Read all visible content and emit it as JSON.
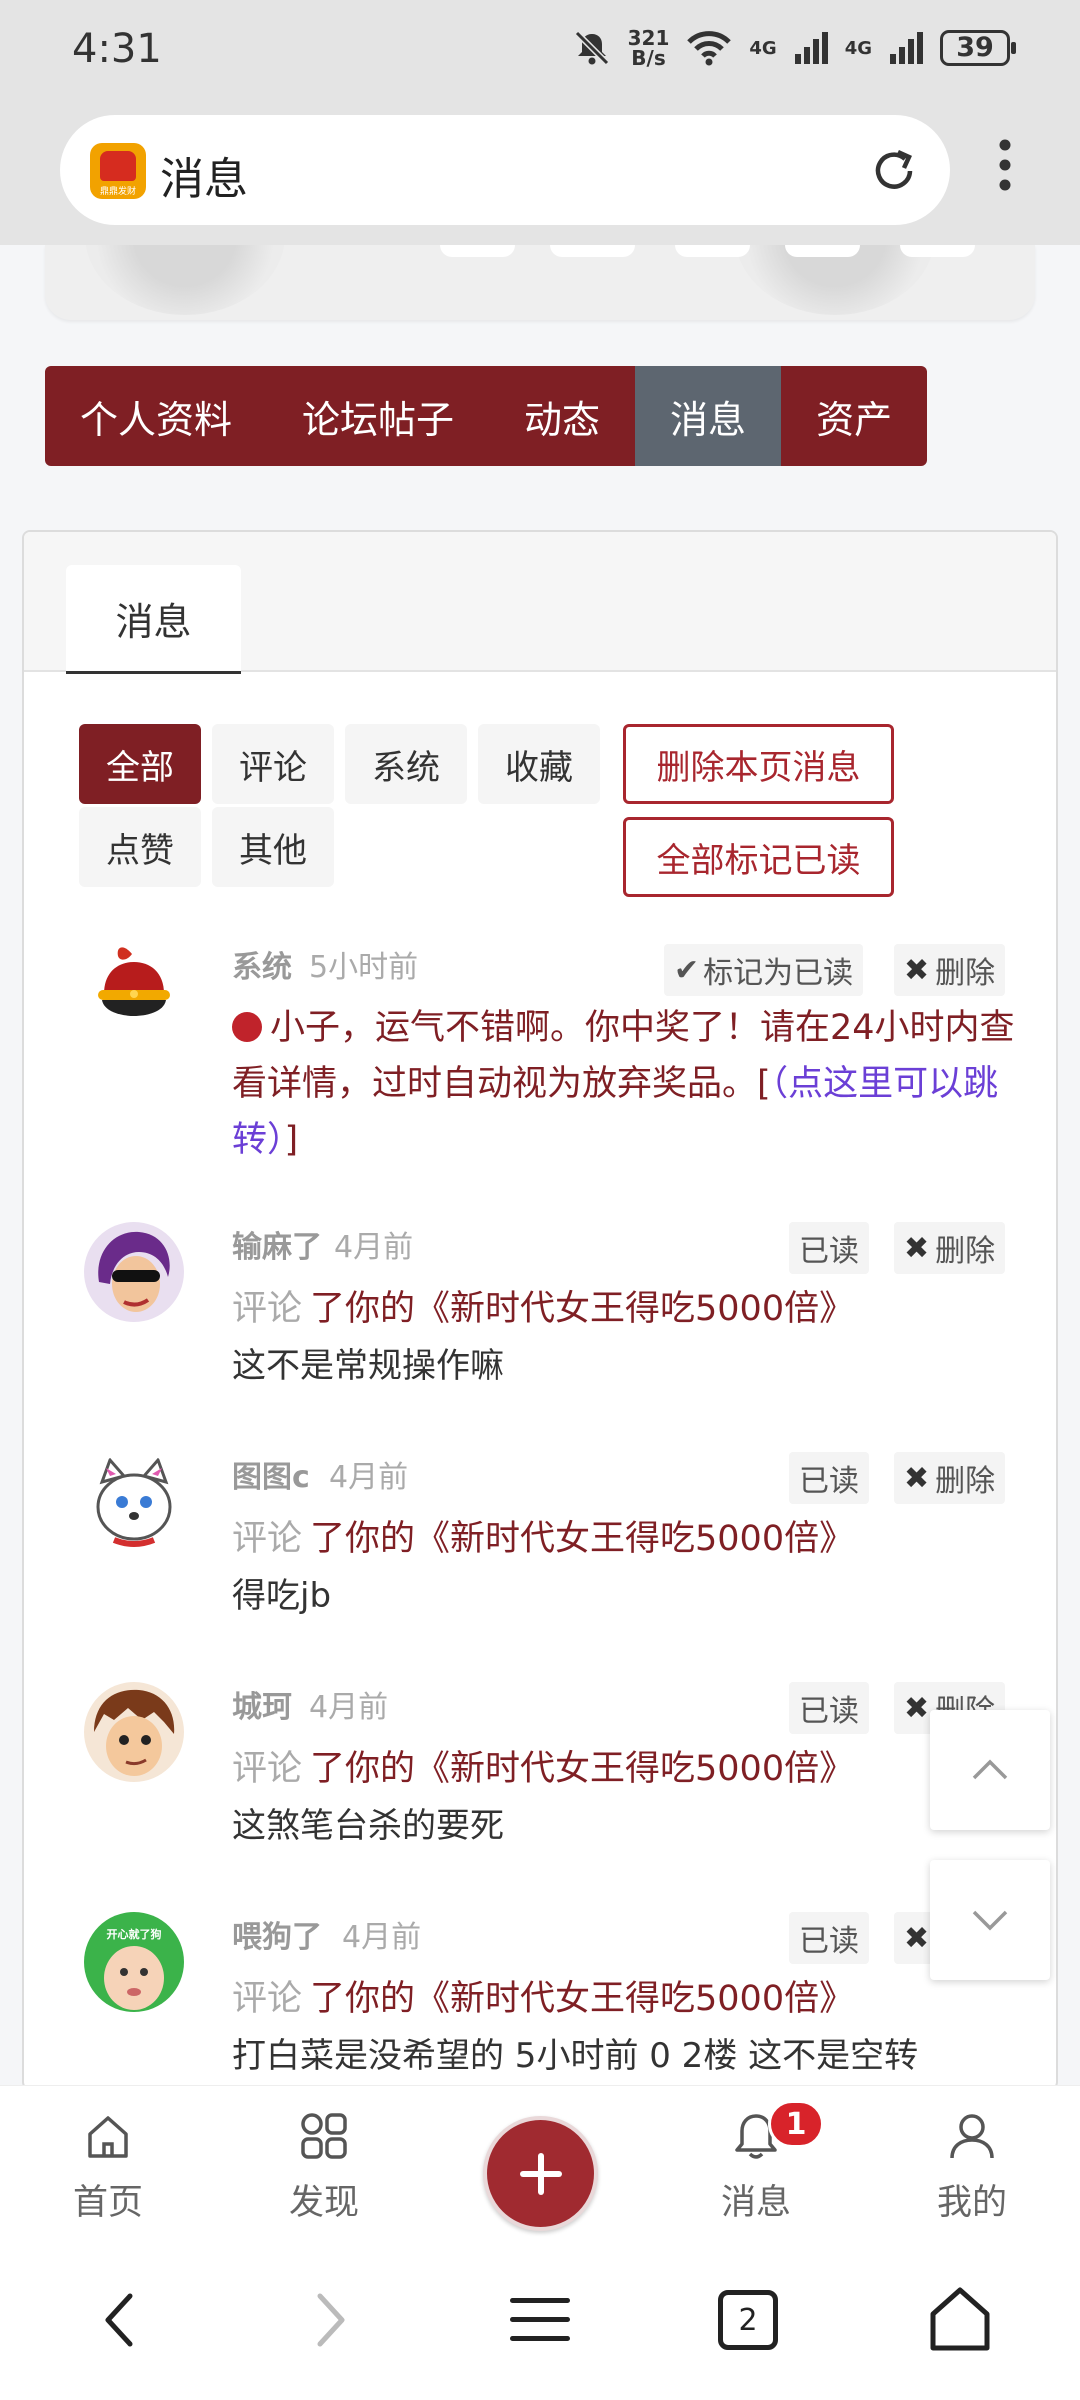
{
  "status_bar": {
    "time": "4:31",
    "net_speed_value": "321",
    "net_speed_unit": "B/s",
    "signal_1": "4G",
    "signal_2": "4G",
    "battery": "39"
  },
  "browser": {
    "title": "消息",
    "logo_text": "鼎鼎发财"
  },
  "profile_tabs": [
    "个人资料",
    "论坛帖子",
    "动态",
    "消息",
    "资产"
  ],
  "profile_tabs_active": "消息",
  "card_tab": "消息",
  "filters": {
    "all": "全部",
    "comment": "评论",
    "system": "系统",
    "favorite": "收藏",
    "like": "点赞",
    "other": "其他",
    "delete_page": "删除本页消息",
    "mark_all_read": "全部标记已读"
  },
  "messages": {
    "system": {
      "user": "系统",
      "time": "5小时前",
      "mark_read": "标记为已读",
      "delete": "删除",
      "text": "小子，运气不错啊。你中奖了！请在24小时内查看详情，过时自动视为放弃奖品。[",
      "link": "（点这里可以跳转）",
      "tail": "]"
    },
    "m1": {
      "user": "输麻了",
      "time": "4月前",
      "status": "已读",
      "delete": "删除",
      "verb": "评论",
      "target": "了你的《新时代女王得吃5000倍》",
      "content": "这不是常规操作嘛"
    },
    "m2": {
      "user": "图图c",
      "time": "4月前",
      "status": "已读",
      "delete": "删除",
      "verb": "评论",
      "target": "了你的《新时代女王得吃5000倍》",
      "content": "得吃jb"
    },
    "m3": {
      "user": "城珂",
      "time": "4月前",
      "status": "已读",
      "delete": "删除",
      "verb": "评论",
      "target": "了你的《新时代女王得吃5000倍》",
      "content": "这煞笔台杀的要死"
    },
    "m4": {
      "user": "喂狗了",
      "time": "4月前",
      "status": "已读",
      "verb": "评论",
      "target": "了你的《新时代女王得吃5000倍》",
      "content": "打白菜是没希望的 5小时前 0 2楼 这不是空转",
      "avatar_text": "开心就了狗"
    }
  },
  "bottom_nav": {
    "home": "首页",
    "discover": "发现",
    "messages": "消息",
    "messages_badge": "1",
    "mine": "我的"
  },
  "system_nav": {
    "tabs_count": "2"
  },
  "colors": {
    "brand": "#7f1f24",
    "active_tab": "#5d6670",
    "badge": "#d8232a",
    "link": "#6b3fd6"
  }
}
